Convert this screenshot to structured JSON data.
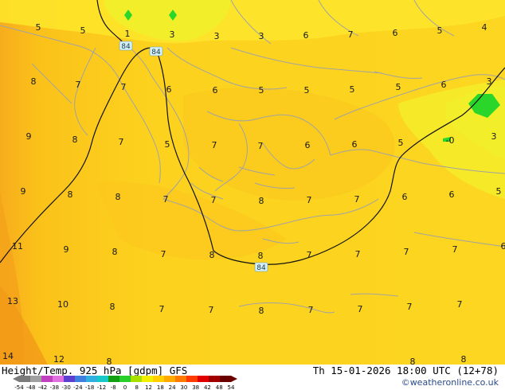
{
  "footer": {
    "title": "Height/Temp. 925 hPa [gdpm] GFS",
    "datetime": "Th 15-01-2026 18:00 UTC (12+78)",
    "credit": "©weatheronline.co.uk"
  },
  "colorbar": {
    "ticks": [
      "-54",
      "-48",
      "-42",
      "-38",
      "-30",
      "-24",
      "-18",
      "-12",
      "-8",
      "0",
      "8",
      "12",
      "18",
      "24",
      "30",
      "38",
      "42",
      "48",
      "54"
    ],
    "colors": [
      "#7a7a7a",
      "#a0a0a0",
      "#c040c0",
      "#e070e0",
      "#5a3fd0",
      "#3f7fe0",
      "#2fb0e0",
      "#18c8c8",
      "#12a012",
      "#2ad02a",
      "#a8e000",
      "#f0f000",
      "#ffd000",
      "#ffaa00",
      "#ff7a00",
      "#ff3a00",
      "#e00000",
      "#a00000",
      "#6a0000"
    ]
  },
  "contour_labels": [
    "84",
    "84",
    "84"
  ],
  "temperature_labels": [
    {
      "text": "5"
    },
    {
      "text": "5"
    },
    {
      "text": "1"
    },
    {
      "text": "3"
    },
    {
      "text": "3"
    },
    {
      "text": "3"
    },
    {
      "text": "6"
    },
    {
      "text": "7"
    },
    {
      "text": "6"
    },
    {
      "text": "5"
    },
    {
      "text": "4"
    },
    {
      "text": "8"
    },
    {
      "text": "7"
    },
    {
      "text": "7"
    },
    {
      "text": "6"
    },
    {
      "text": "6"
    },
    {
      "text": "5"
    },
    {
      "text": "5"
    },
    {
      "text": "5"
    },
    {
      "text": "5"
    },
    {
      "text": "6"
    },
    {
      "text": "3"
    },
    {
      "text": "9"
    },
    {
      "text": "8"
    },
    {
      "text": "7"
    },
    {
      "text": "5"
    },
    {
      "text": "7"
    },
    {
      "text": "7"
    },
    {
      "text": "6"
    },
    {
      "text": "6"
    },
    {
      "text": "5"
    },
    {
      "text": "-0"
    },
    {
      "text": "3"
    },
    {
      "text": "9"
    },
    {
      "text": "8"
    },
    {
      "text": "8"
    },
    {
      "text": "7"
    },
    {
      "text": "7"
    },
    {
      "text": "8"
    },
    {
      "text": "7"
    },
    {
      "text": "7"
    },
    {
      "text": "6"
    },
    {
      "text": "6"
    },
    {
      "text": "5"
    },
    {
      "text": "11"
    },
    {
      "text": "9"
    },
    {
      "text": "8"
    },
    {
      "text": "7"
    },
    {
      "text": "8"
    },
    {
      "text": "8"
    },
    {
      "text": "7"
    },
    {
      "text": "7"
    },
    {
      "text": "7"
    },
    {
      "text": "7"
    },
    {
      "text": "6"
    },
    {
      "text": "13"
    },
    {
      "text": "10"
    },
    {
      "text": "8"
    },
    {
      "text": "7"
    },
    {
      "text": "7"
    },
    {
      "text": "8"
    },
    {
      "text": "7"
    },
    {
      "text": "7"
    },
    {
      "text": "7"
    },
    {
      "text": "7"
    },
    {
      "text": "14"
    },
    {
      "text": "12"
    },
    {
      "text": "8"
    },
    {
      "text": "8"
    },
    {
      "text": "8"
    }
  ]
}
